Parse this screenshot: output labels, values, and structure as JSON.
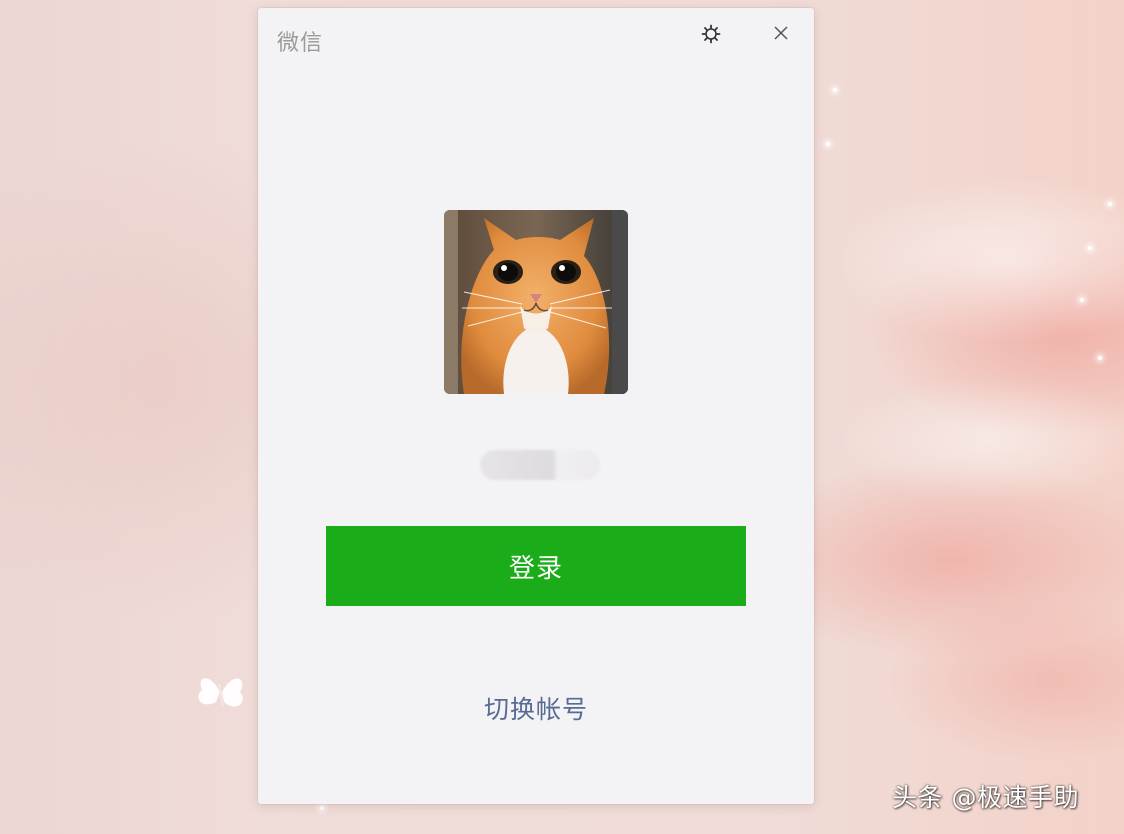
{
  "window": {
    "title": "微信",
    "settings_icon": "gear-icon",
    "close_icon": "close-icon"
  },
  "account": {
    "avatar": "orange-white-cat-photo",
    "username_state": "blurred"
  },
  "actions": {
    "login_label": "登录",
    "switch_account_label": "切换帐号"
  },
  "watermark": {
    "text": "头条 @极速手助"
  },
  "colors": {
    "login_button": "#1aad19",
    "link": "#576b95",
    "window_bg": "#f3f2f4",
    "title_text": "#9a9a9a"
  }
}
